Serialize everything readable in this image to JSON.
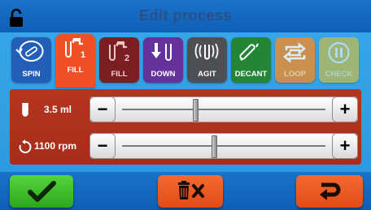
{
  "title": "Edit process",
  "tabs": [
    {
      "id": "spin",
      "label": "SPIN",
      "icon": "spin-icon"
    },
    {
      "id": "fill1",
      "label": "FILL",
      "icon": "fill-1-icon",
      "badge": "1",
      "selected": true
    },
    {
      "id": "fill2",
      "label": "FILL",
      "icon": "fill-2-icon",
      "badge": "2"
    },
    {
      "id": "down",
      "label": "DOWN",
      "icon": "down-icon"
    },
    {
      "id": "agit",
      "label": "AGIT",
      "icon": "agitate-icon"
    },
    {
      "id": "decant",
      "label": "DECANT",
      "icon": "decant-icon"
    },
    {
      "id": "loop",
      "label": "LOOP",
      "icon": "loop-icon"
    },
    {
      "id": "check",
      "label": "CHECK",
      "icon": "check-pause-icon"
    }
  ],
  "params": {
    "volume": {
      "value": "3.5 ml",
      "icon": "tube-icon",
      "level": 0.36
    },
    "speed": {
      "value": "1100 rpm",
      "icon": "rotation-icon",
      "level": 0.45
    }
  },
  "buttons": {
    "minus": "−",
    "plus": "+"
  },
  "footer": {
    "confirm_icon": "checkmark-icon",
    "delete_icon": "trash-x-icon",
    "back_icon": "return-arrow-icon"
  },
  "colors": {
    "header": "#1a73c9",
    "background": "#39a9ea",
    "panel": "#b5351e",
    "selected_tab": "#ef5026",
    "confirm": "#3cc12b",
    "action": "#ec5421"
  }
}
